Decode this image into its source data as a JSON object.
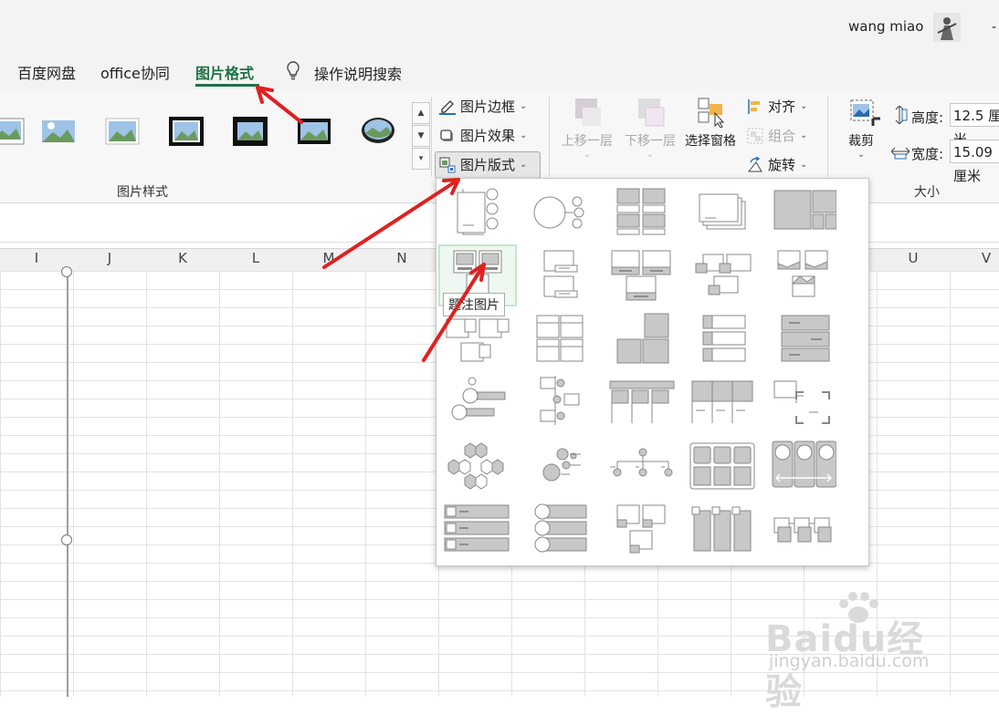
{
  "titlebar": {
    "user_name": "wang miao",
    "minimize": "-"
  },
  "tabs": [
    {
      "label": "百度网盘"
    },
    {
      "label": "office协同"
    },
    {
      "label": "图片格式"
    }
  ],
  "tell_me": {
    "label": "操作说明搜索"
  },
  "ribbon": {
    "picture_styles_group": "图片样式",
    "picture_border": "图片边框",
    "picture_effects": "图片效果",
    "picture_layout": "图片版式",
    "bring_forward": "上移一层",
    "send_backward": "下移一层",
    "selection_pane": "选择窗格",
    "align": "对齐",
    "group": "组合",
    "rotate": "旋转",
    "crop": "裁剪",
    "size_group": "大小",
    "height_label": "高度:",
    "height_value": "12.5 厘米",
    "width_label": "宽度:",
    "width_value": "15.09 厘米"
  },
  "columns": [
    "I",
    "J",
    "K",
    "L",
    "M",
    "N",
    "U",
    "V"
  ],
  "dropdown": {
    "tooltip": "题注图片"
  },
  "watermark": {
    "logo": "Baidu经验",
    "url": "jingyan.baidu.com"
  },
  "colors": {
    "accent": "#1e7145",
    "arrow": "#e02020",
    "layout_fill": "#bdbdbd",
    "layout_stroke": "#7a7a7a"
  }
}
